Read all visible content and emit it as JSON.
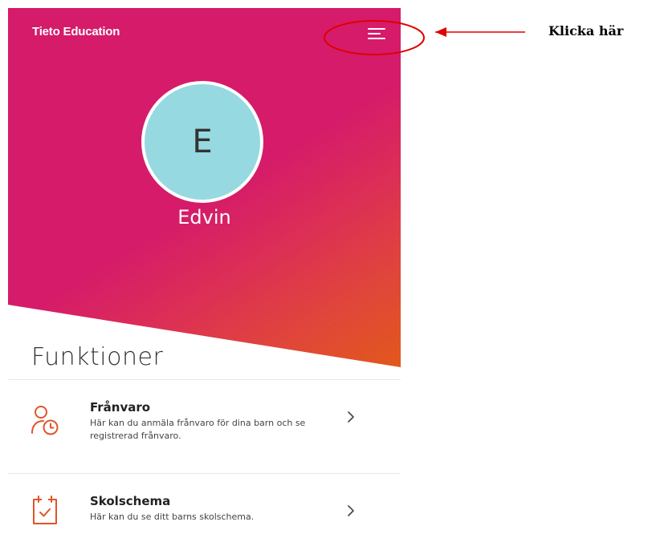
{
  "app": {
    "brand": "Tieto Education"
  },
  "profile": {
    "initial": "E",
    "name": "Edvin"
  },
  "section": {
    "title": "Funktioner"
  },
  "functions": [
    {
      "title": "Frånvaro",
      "description": "Här kan du anmäla frånvaro för dina barn och se registrerad frånvaro.",
      "icon": "absence-person-clock-icon"
    },
    {
      "title": "Skolschema",
      "description": "Här kan du se ditt barns skolschema.",
      "icon": "calendar-check-icon"
    }
  ],
  "annotation": {
    "text": "Klicka här"
  },
  "colors": {
    "hero_pink": "#d51b6a",
    "hero_orange": "#e2581c",
    "avatar": "#97d9e1",
    "icon_orange": "#e0552a",
    "annotation_red": "#e00000"
  }
}
